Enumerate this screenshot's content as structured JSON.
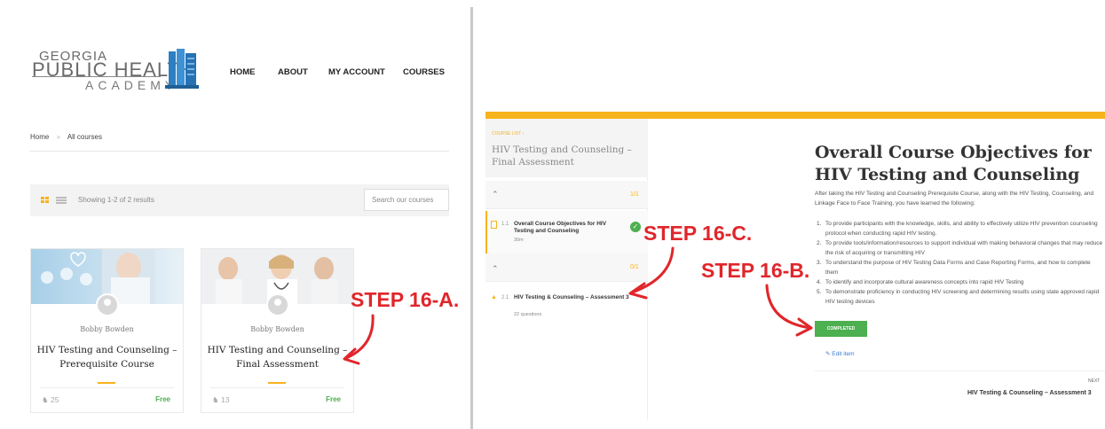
{
  "left": {
    "logo": {
      "line1": "GEORGIA",
      "line2": "PUBLIC HEALTH",
      "line3": "ACADEMY"
    },
    "nav": [
      "HOME",
      "ABOUT",
      "MY ACCOUNT",
      "COURSES"
    ],
    "breadcrumb": {
      "home": "Home",
      "sep": "»",
      "current": "All courses"
    },
    "results": "Showing 1-2 of 2 results",
    "search_placeholder": "Search our courses",
    "cards": [
      {
        "author": "Bobby Bowden",
        "title": "HIV Testing and Counseling – Prerequisite Course",
        "students": "25",
        "price": "Free"
      },
      {
        "author": "Bobby Bowden",
        "title": "HIV Testing and Counseling – Final Assessment",
        "students": "13",
        "price": "Free"
      }
    ]
  },
  "steps": {
    "a": "STEP 16-A.",
    "b": "STEP 16-B.",
    "c": "STEP 16-C."
  },
  "right": {
    "course_list_label": "COURSE LIST",
    "sidebar_title": "HIV Testing and Counseling – Final Assessment",
    "sections": [
      {
        "count": "1/1",
        "item_num": "1.1",
        "item_title": "Overall Course Objectives for HIV Testing and Counseling",
        "item_sub": "30m"
      },
      {
        "count": "0/1",
        "item_num": "2.1",
        "item_title": "HIV Testing & Counseling – Assessment 3",
        "item_sub": "22 questions"
      }
    ],
    "title": "Overall Course Objectives for HIV Testing and Counseling",
    "intro": "After taking the HIV Testing and Counseling Prerequisite Course, along with the HIV Testing, Counseling, and Linkage Face to Face Training, you have learned the following:",
    "objectives": [
      "To provide participants with the knowledge, skills, and ability to effectively utilize HIV prevention counseling protocol when conducting rapid HIV testing.",
      "To provide tools/information/resources to support individual with making behavioral changes that may reduce the risk of acquiring or transmitting HIV",
      "To understand the purpose of HIV Testing Data Forms and Case Reporting Forms, and how to complete them",
      "To identify and incorporate cultural awareness concepts into rapid HIV Testing",
      "To demonstrate proficiency in conducting HIV screening and determining results using state approved rapid HIV testing devices"
    ],
    "completed_label": "COMPLETED",
    "edit_label": "Edit item",
    "next_label": "NEXT",
    "next_title": "HIV Testing & Counseling – Assessment 3"
  },
  "colors": {
    "accent": "#f7b31c",
    "success": "#4caf50",
    "annotation": "#e0262b",
    "link": "#3b7bd1"
  },
  "icons": [
    "book-icon",
    "grid-view-icon",
    "list-view-icon",
    "user-avatar-icon",
    "students-icon",
    "chevron-up-icon",
    "document-icon",
    "quiz-icon",
    "check-circle-icon",
    "edit-icon"
  ]
}
